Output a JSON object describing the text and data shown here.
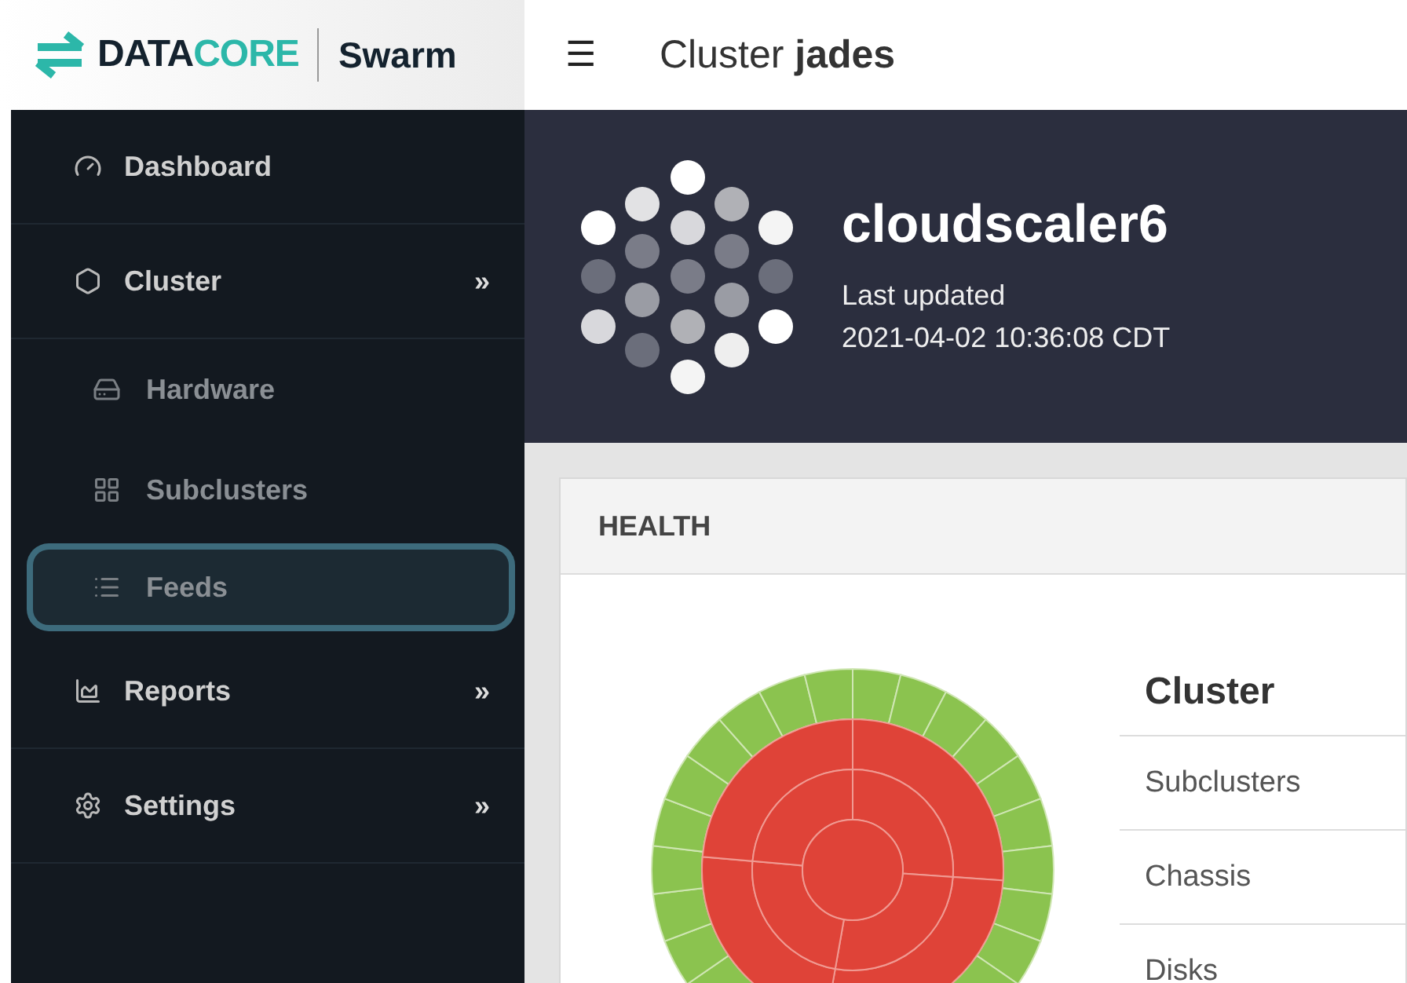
{
  "logo": {
    "brand_a": "DATA",
    "brand_b": "CORE",
    "product": "Swarm"
  },
  "header": {
    "menu_glyph": "☰",
    "title": "Cluster **jades**"
  },
  "sidebar": {
    "items": [
      {
        "label": "Dashboard",
        "selected": false
      },
      {
        "label": "Cluster",
        "selected": false,
        "arrow": "»",
        "children": [
          {
            "label": "Hardware",
            "selected": false
          },
          {
            "label": "Subclusters",
            "selected": false
          },
          {
            "label": "Feeds",
            "selected": true
          }
        ]
      },
      {
        "label": "Reports",
        "selected": false,
        "arrow": "»"
      },
      {
        "label": "Settings",
        "selected": false,
        "arrow": "»"
      }
    ]
  },
  "banner": {
    "name": "cloudscaler6",
    "updated_label": "Last updated",
    "updated_time": "2021-04-02 10:36:08 CDT"
  },
  "health": {
    "title": "HEALTH",
    "table": {
      "heading": "Cluster",
      "rows": [
        "Subclusters",
        "Chassis",
        "Disks"
      ]
    }
  }
}
